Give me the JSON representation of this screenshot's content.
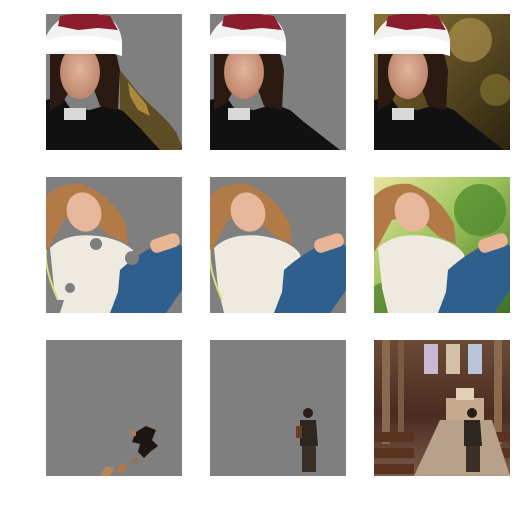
{
  "figure": {
    "rows": [
      {
        "subject": "woman-in-knit-hat",
        "panels": [
          {
            "kind": "predicted-mask",
            "background": "#7f7f7f"
          },
          {
            "kind": "ground-truth-mask",
            "background": "#7f7f7f"
          },
          {
            "kind": "original-image",
            "background": "#6f5a2c"
          }
        ]
      },
      {
        "subject": "smiling-woman-sitting",
        "panels": [
          {
            "kind": "predicted-mask",
            "background": "#7f7f7f"
          },
          {
            "kind": "ground-truth-mask",
            "background": "#7f7f7f"
          },
          {
            "kind": "original-image",
            "background": "#5d8f37"
          }
        ]
      },
      {
        "subject": "person-in-church",
        "panels": [
          {
            "kind": "predicted-mask",
            "background": "#7f7f7f"
          },
          {
            "kind": "ground-truth-mask",
            "background": "#7f7f7f"
          },
          {
            "kind": "original-image",
            "background": "#4a2c22"
          }
        ]
      }
    ]
  }
}
